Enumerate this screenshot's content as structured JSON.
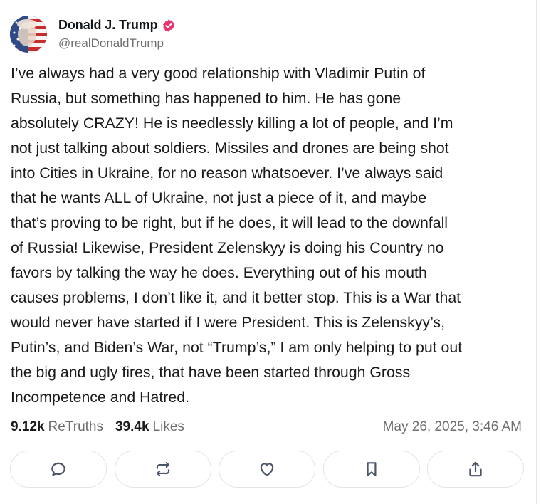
{
  "author": {
    "display_name": "Donald J. Trump",
    "handle": "@realDonaldTrump",
    "verified_icon": "verified-badge-icon",
    "verified_color": "#e8336d"
  },
  "post": {
    "text": "I’ve always had a very good relationship with Vladimir Putin of\nRussia, but something has happened to him. He has gone\nabsolutely CRAZY! He is needlessly killing a lot of people, and I’m\nnot just talking about soldiers. Missiles and drones are being shot\ninto Cities in Ukraine, for no reason whatsoever. I’ve always said\nthat he wants ALL of Ukraine, not just a piece of it, and maybe\nthat’s proving to be right, but if he does, it will lead to the downfall\nof Russia! Likewise, President Zelenskyy is doing his Country no\nfavors by talking the way he does. Everything out of his mouth\ncauses problems, I don’t like it, and it better stop. This is a War that\nwould never have started if I were President. This is Zelenskyy’s,\nPutin’s, and Biden’s War, not “Trump’s,” I am only helping to put out\nthe big and ugly fires, that have been started through Gross\nIncompetence and Hatred."
  },
  "stats": {
    "retruths_count": "9.12k",
    "retruths_label": "ReTruths",
    "likes_count": "39.4k",
    "likes_label": "Likes",
    "timestamp": "May 26, 2025, 3:46 AM"
  },
  "actions": [
    {
      "icon": "reply-icon"
    },
    {
      "icon": "retruth-icon"
    },
    {
      "icon": "like-icon"
    },
    {
      "icon": "bookmark-icon"
    },
    {
      "icon": "share-icon"
    }
  ],
  "colors": {
    "text": "#1a1a1a",
    "muted": "#6e6e6e",
    "border": "#e1e4e8",
    "icon": "#4a5568"
  }
}
